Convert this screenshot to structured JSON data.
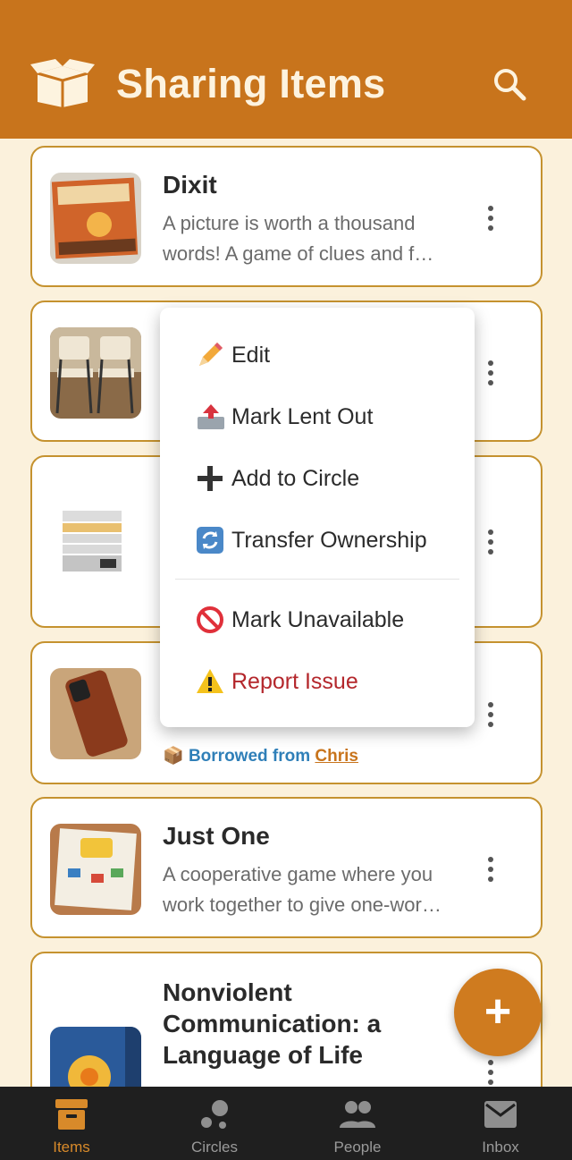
{
  "app": {
    "title": "Sharing Items",
    "accent": "#c8741c",
    "logo_icon": "open-box-icon",
    "search_icon": "search-icon"
  },
  "items": [
    {
      "title": "Dixit",
      "description": "A picture is worth a thousand words! A game of clues and f…",
      "thumb_icon": "dixit-box-photo"
    },
    {
      "title": "",
      "description": "",
      "thumb_icon": "folding-chairs-photo"
    },
    {
      "title": "",
      "description": "",
      "thumb_icon": "food-dehydrator-photo"
    },
    {
      "title": "",
      "description": "",
      "thumb_icon": "phone-case-photo",
      "borrow_prefix": "Borrowed from",
      "borrow_user": "Chris",
      "borrow_icon": "package-icon"
    },
    {
      "title": "Just One",
      "description": "A cooperative game where you work together to give one-wor…",
      "thumb_icon": "just-one-box-photo"
    },
    {
      "title": "Nonviolent Communication: a Language of Life",
      "description": "",
      "thumb_icon": "book-cover-photo"
    }
  ],
  "menu": {
    "edit": "Edit",
    "mark_lent_out": "Mark Lent Out",
    "add_to_circle": "Add to Circle",
    "transfer_ownership": "Transfer Ownership",
    "mark_unavailable": "Mark Unavailable",
    "report_issue": "Report Issue"
  },
  "fab": {
    "label": "+",
    "icon": "plus-icon"
  },
  "nav": {
    "items": [
      {
        "label": "Items",
        "icon": "archive-box-icon",
        "active": true
      },
      {
        "label": "Circles",
        "icon": "circles-icon",
        "active": false
      },
      {
        "label": "People",
        "icon": "people-icon",
        "active": false
      },
      {
        "label": "Inbox",
        "icon": "mail-icon",
        "active": false
      }
    ],
    "active_color": "#d88a2a",
    "inactive_color": "#9a9a9a"
  }
}
